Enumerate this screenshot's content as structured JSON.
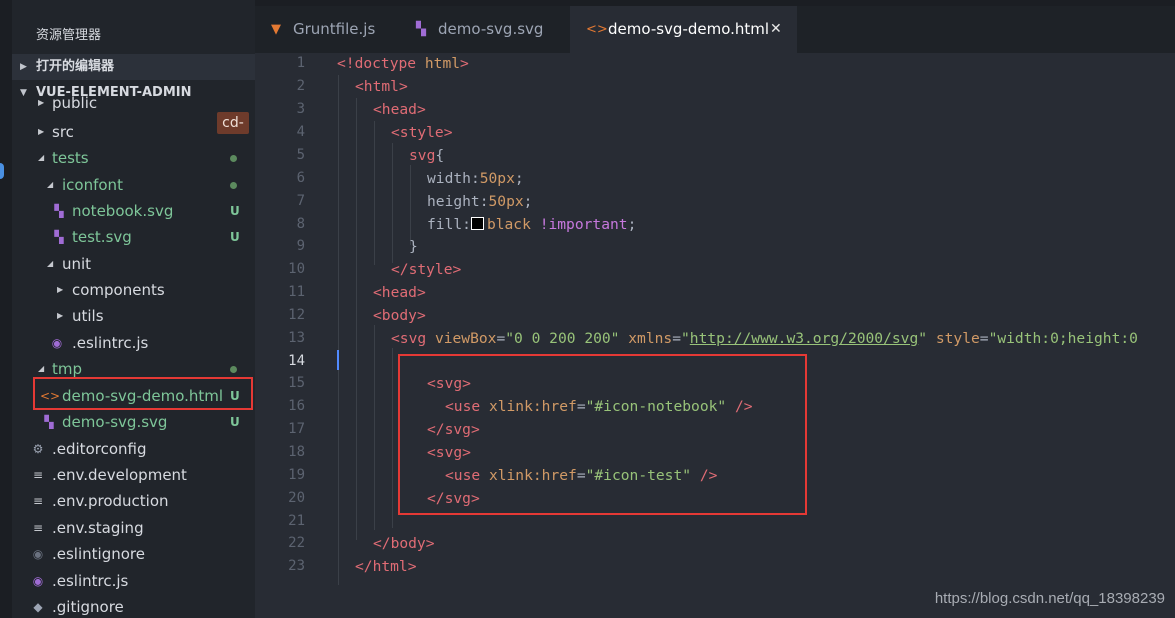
{
  "sidebar": {
    "title": "资源管理器",
    "open_editors": "打开的编辑器",
    "project": "VUE-ELEMENT-ADMIN",
    "tooltip": "cd-",
    "items": [
      {
        "label": "public",
        "badge": ""
      },
      {
        "label": "src",
        "badge": ""
      },
      {
        "label": "tests",
        "badge": ""
      },
      {
        "label": "iconfont",
        "badge": ""
      },
      {
        "label": "notebook.svg",
        "badge": "U"
      },
      {
        "label": "test.svg",
        "badge": "U"
      },
      {
        "label": "unit",
        "badge": ""
      },
      {
        "label": "components",
        "badge": ""
      },
      {
        "label": "utils",
        "badge": ""
      },
      {
        "label": ".eslintrc.js",
        "badge": ""
      },
      {
        "label": "tmp",
        "badge": ""
      },
      {
        "label": "demo-svg-demo.html",
        "badge": "U"
      },
      {
        "label": "demo-svg.svg",
        "badge": "U"
      },
      {
        "label": ".editorconfig",
        "badge": ""
      },
      {
        "label": ".env.development",
        "badge": ""
      },
      {
        "label": ".env.production",
        "badge": ""
      },
      {
        "label": ".env.staging",
        "badge": ""
      },
      {
        "label": ".eslintignore",
        "badge": ""
      },
      {
        "label": ".eslintrc.js",
        "badge": ""
      },
      {
        "label": ".gitignore",
        "badge": ""
      }
    ]
  },
  "tabs": [
    {
      "label": "Gruntfile.js",
      "icon": "grunt-icon"
    },
    {
      "label": "demo-svg.svg",
      "icon": "svg-file-icon"
    },
    {
      "label": "demo-svg-demo.html",
      "icon": "html-file-icon",
      "close": "✕"
    }
  ],
  "editor": {
    "line_numbers": [
      "1",
      "2",
      "3",
      "4",
      "5",
      "6",
      "7",
      "8",
      "9",
      "10",
      "11",
      "12",
      "13",
      "14",
      "15",
      "16",
      "17",
      "18",
      "19",
      "20",
      "21",
      "22",
      "23"
    ],
    "lines": [
      "<!doctype html>",
      "<html>",
      "<head>",
      "<style>",
      "svg{",
      "width:50px;",
      "height:50px;",
      "fill:black !important;",
      "}",
      "</style>",
      "<head>",
      "<body>",
      "<svg viewBox=\"0 0 200 200\" xmlns=\"http://www.w3.org/2000/svg\" style=\"width:0;height:0",
      "",
      "<svg>",
      "<use xlink:href=\"#icon-notebook\" />",
      "</svg>",
      "<svg>",
      "<use xlink:href=\"#icon-test\" />",
      "</svg>",
      "",
      "</body>",
      "</html>"
    ],
    "tokens": {
      "doctype": "<!doctype",
      "html_kw": "html",
      "gt": ">",
      "lt_html": "<html",
      "lt_head": "<head",
      "lt_style": "<style",
      "svg_sel": "svg",
      "brace_open": "{",
      "width_prop": "width",
      "width_val": "50px",
      "height_prop": "height",
      "height_val": "50px",
      "fill_prop": "fill",
      "fill_val": "black",
      "important": "!important",
      "colon": ":",
      "semi": ";",
      "brace_close": "}",
      "close_style": "</style",
      "lt_body": "<body",
      "lt_svg": "<svg",
      "viewbox_attr": " viewBox",
      "viewbox_val": "\"0 0 200 200\"",
      "xmlns_attr": " xmlns",
      "xmlns_q": "\"",
      "xmlns_url": "http://www.w3.org/2000/svg",
      "style_attr": " style",
      "style_val": "\"width:0;height:0",
      "eq": "=",
      "use_tag": "<use",
      "xlink_attr": " xlink:href",
      "href_notebook": "\"#icon-notebook\"",
      "href_test": "\"#icon-test\"",
      "selfclose": " />",
      "close_svg": "</svg",
      "close_body": "</body",
      "close_html": "</html"
    }
  },
  "watermark": "https://blog.csdn.net/qq_18398239",
  "colors": {
    "tag": "#e06c75",
    "attr": "#d19a66",
    "string": "#98c379",
    "keyword": "#c678dd",
    "git_untracked": "#7ec699",
    "highlight_box": "#e53935"
  }
}
